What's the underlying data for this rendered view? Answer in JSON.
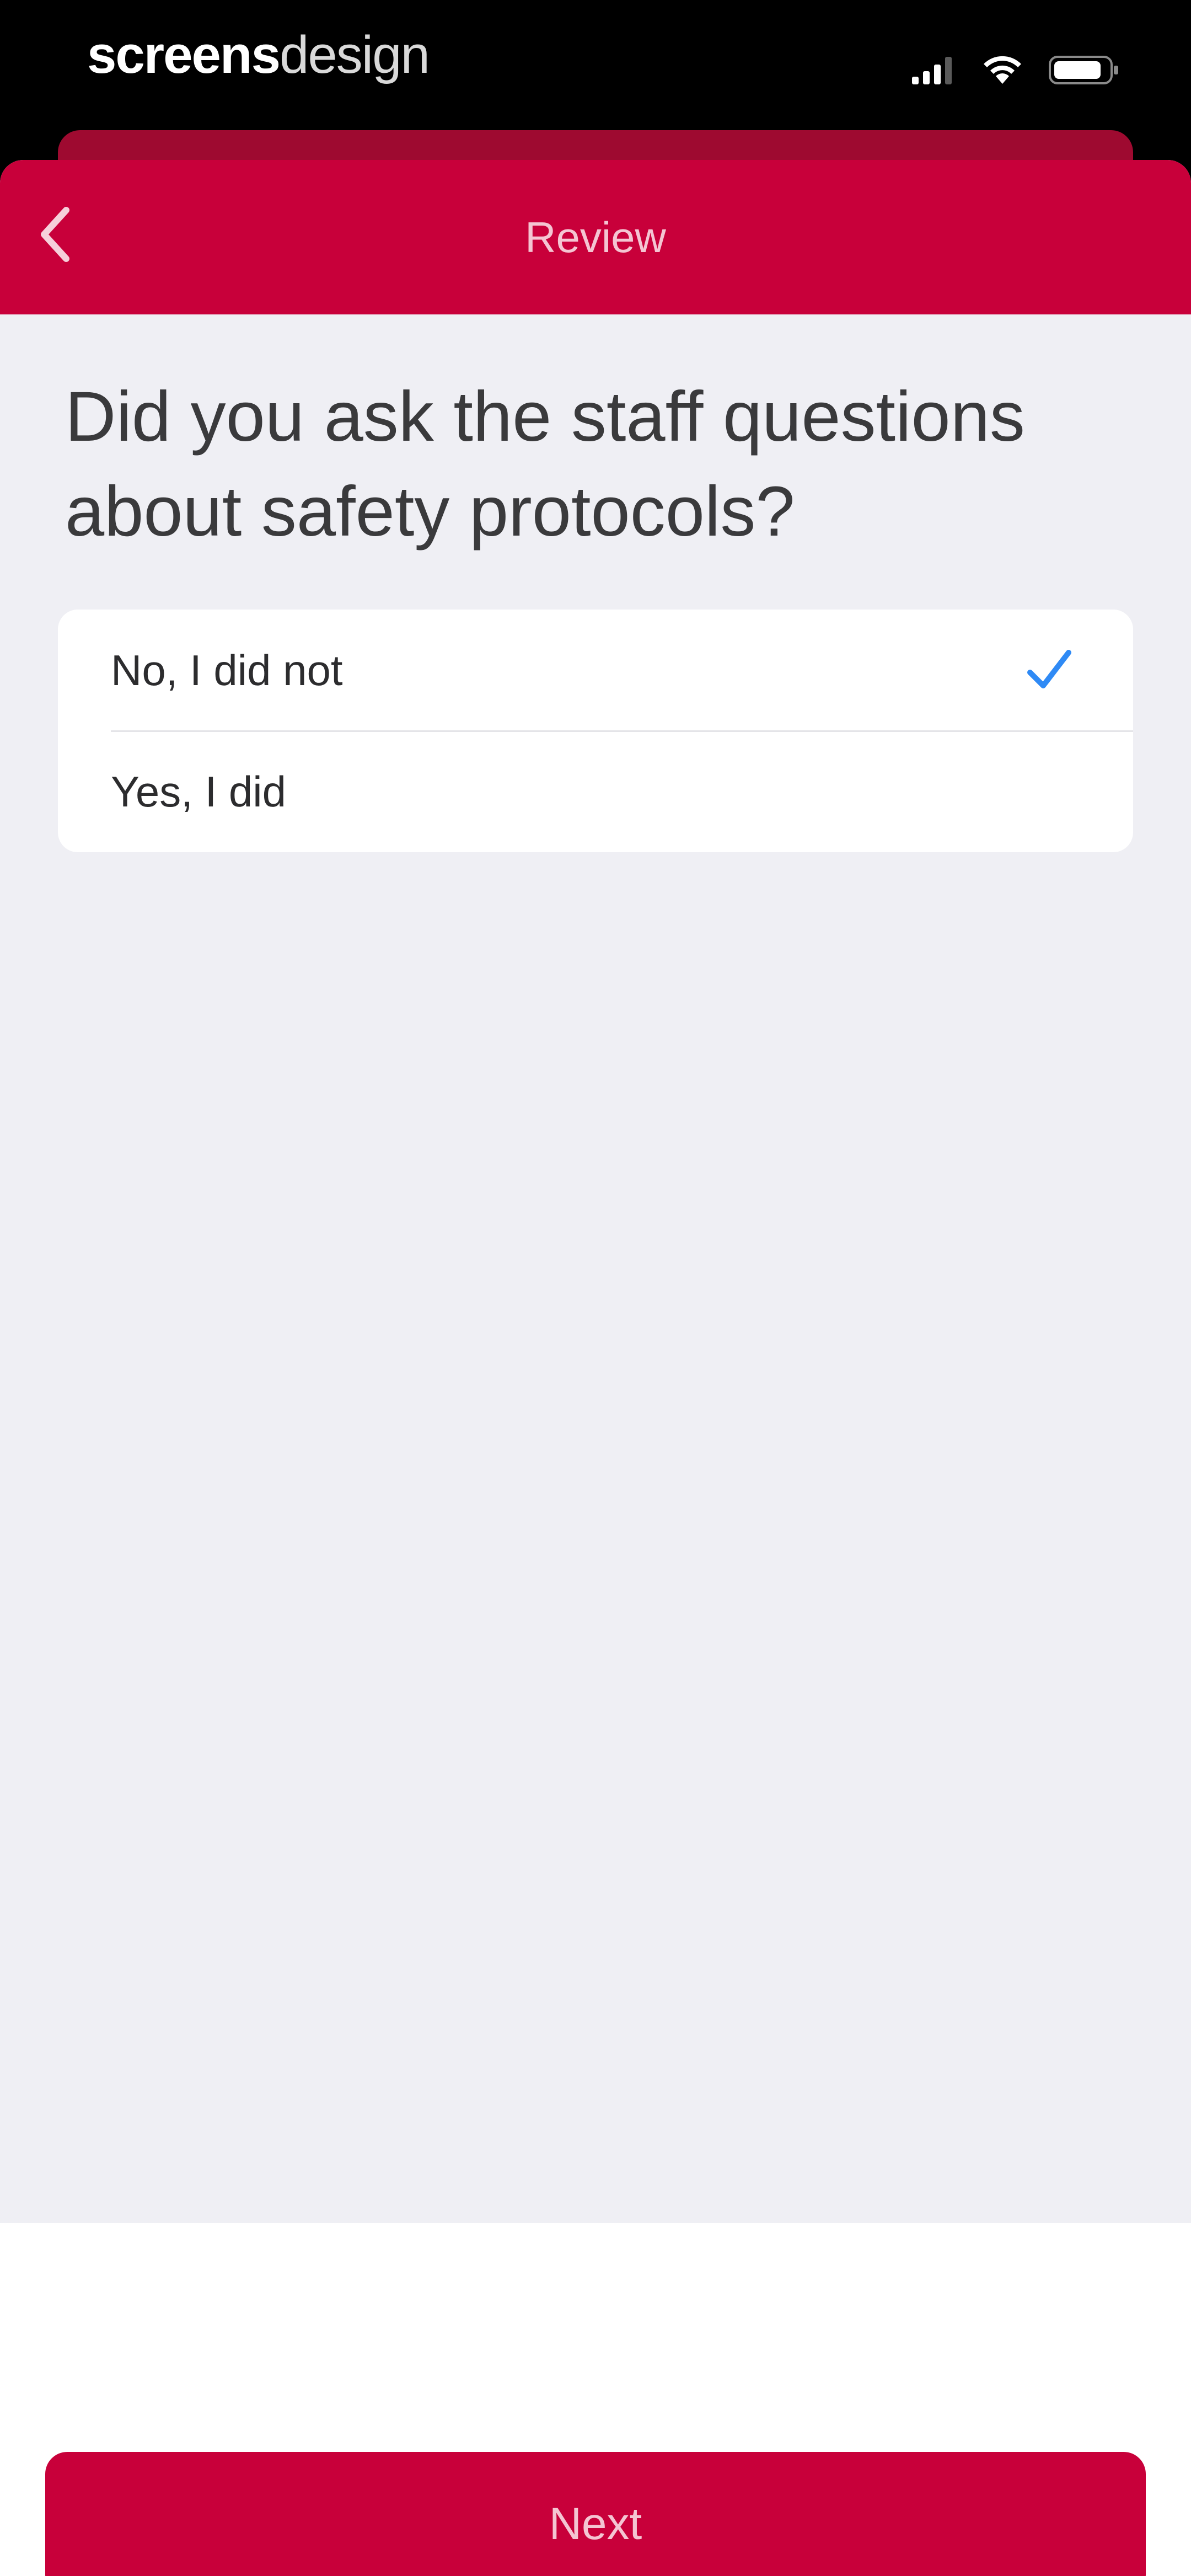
{
  "status_bar": {
    "watermark_bold": "screens",
    "watermark_light": "design",
    "icons": [
      "signal-icon",
      "wifi-icon",
      "battery-icon"
    ]
  },
  "nav": {
    "title": "Review",
    "back_icon": "chevron-left-icon"
  },
  "question": "Did you ask the staff questions about safety protocols?",
  "options": [
    {
      "label": "No, I did not",
      "selected": true
    },
    {
      "label": "Yes, I did",
      "selected": false
    }
  ],
  "footer": {
    "next_label": "Next"
  },
  "colors": {
    "accent": "#c8003a",
    "background": "#efeff4",
    "check": "#2f8af5"
  }
}
